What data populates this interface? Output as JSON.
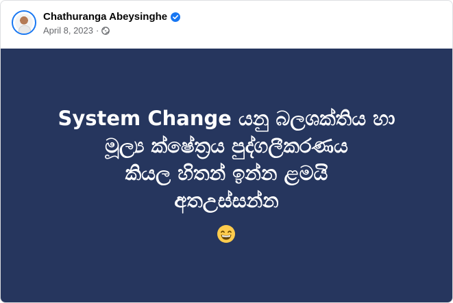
{
  "post": {
    "author": "Chathuranga Abeysinghe",
    "date": "April 8, 2023",
    "separator": "·",
    "verified_icon": "verified-badge-icon",
    "audience_icon": "globe-icon",
    "image_text": "System Change යනු බලශක්තිය හා\nමූල්‍ය ක්ෂේත්‍රය පුද්ගලීකරණය\nකියල හිතන් ඉන්න ළමයි\nඅතඋස්සන්න",
    "emoji_icon": "grinning-face-emoji"
  },
  "colors": {
    "image_background": "#26365e",
    "verified": "#1877f2",
    "meta_text": "#65676b"
  }
}
